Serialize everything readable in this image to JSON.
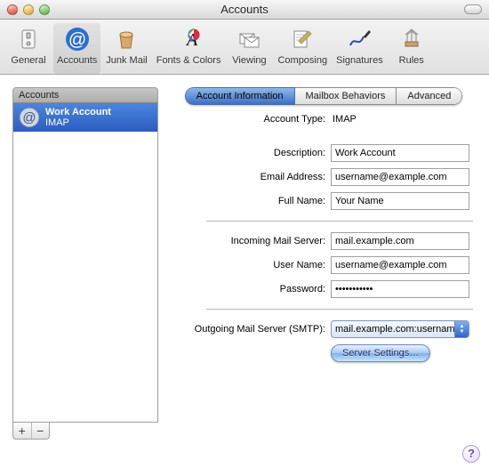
{
  "window": {
    "title": "Accounts"
  },
  "toolbar": {
    "items": [
      {
        "label": "General"
      },
      {
        "label": "Accounts"
      },
      {
        "label": "Junk Mail"
      },
      {
        "label": "Fonts & Colors"
      },
      {
        "label": "Viewing"
      },
      {
        "label": "Composing"
      },
      {
        "label": "Signatures"
      },
      {
        "label": "Rules"
      }
    ]
  },
  "sidebar": {
    "header": "Accounts",
    "account": {
      "name": "Work Account",
      "protocol": "IMAP"
    }
  },
  "main": {
    "tabs": [
      {
        "label": "Account Information"
      },
      {
        "label": "Mailbox Behaviors"
      },
      {
        "label": "Advanced"
      }
    ],
    "account_type_label": "Account Type:",
    "account_type_value": "IMAP",
    "description_label": "Description:",
    "description_value": "Work Account",
    "email_label": "Email Address:",
    "email_value": "username@example.com",
    "fullname_label": "Full Name:",
    "fullname_value": "Your Name",
    "incoming_label": "Incoming Mail Server:",
    "incoming_value": "mail.example.com",
    "username_label": "User Name:",
    "username_value": "username@example.com",
    "password_label": "Password:",
    "password_value": "•••••••••••",
    "smtp_label": "Outgoing Mail Server (SMTP):",
    "smtp_value": "mail.example.com:usernam",
    "server_settings_label": "Server Settings…"
  }
}
